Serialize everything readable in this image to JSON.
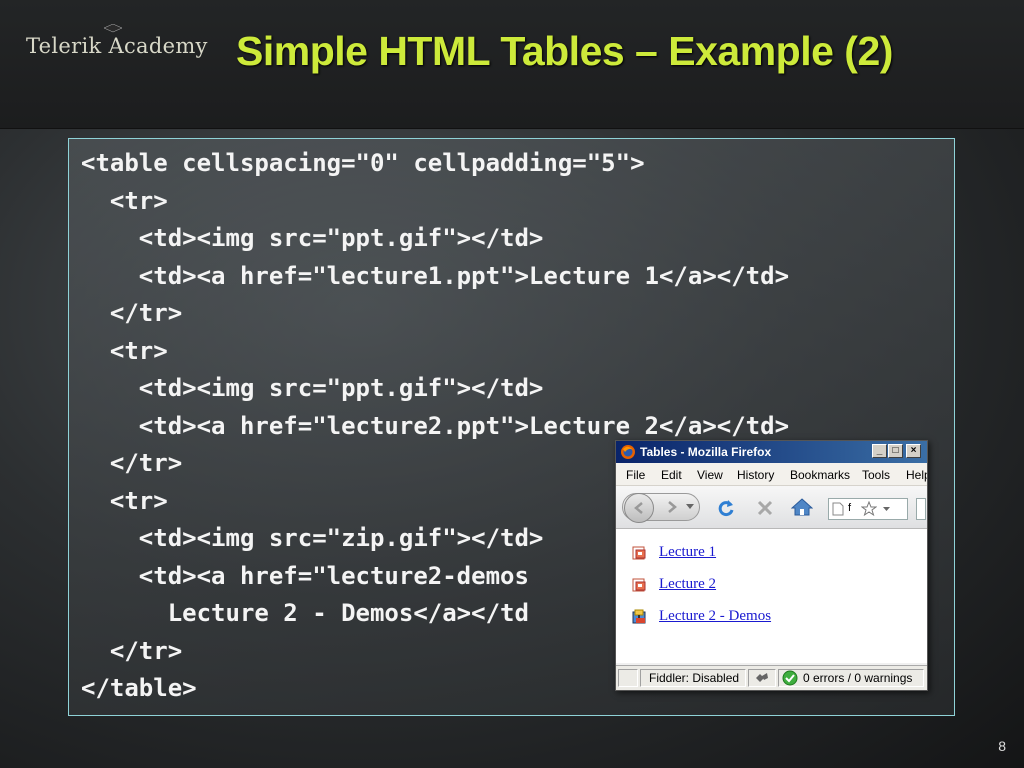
{
  "brand": {
    "logo_text": "Telerik Academy"
  },
  "slide": {
    "title": "Simple HTML Tables – Example (2)",
    "page_number": "8"
  },
  "code": {
    "lines": [
      "<table cellspacing=\"0\" cellpadding=\"5\">",
      "  <tr>",
      "    <td><img src=\"ppt.gif\"></td>",
      "    <td><a href=\"lecture1.ppt\">Lecture 1</a></td>",
      "  </tr>",
      "  <tr>",
      "    <td><img src=\"ppt.gif\"></td>",
      "    <td><a href=\"lecture2.ppt\">Lecture 2</a></td>",
      "  </tr>",
      "  <tr>",
      "    <td><img src=\"zip.gif\"></td>",
      "    <td><a href=\"lecture2-demos",
      "      Lecture 2 - Demos</a></td",
      "  </tr>",
      "</table>"
    ]
  },
  "browser": {
    "window_title": "Tables - Mozilla Firefox",
    "window_buttons": {
      "minimize": "_",
      "maximize": "□",
      "close": "×"
    },
    "menu": [
      "File",
      "Edit",
      "View",
      "History",
      "Bookmarks",
      "Tools",
      "Help"
    ],
    "url_fragment": "f",
    "links": [
      {
        "label": "Lecture 1",
        "icon": "ppt-file-icon"
      },
      {
        "label": "Lecture 2",
        "icon": "ppt-file-icon"
      },
      {
        "label": "Lecture 2 - Demos",
        "icon": "zip-file-icon"
      }
    ],
    "status": {
      "fiddler": "Fiddler: Disabled",
      "errors": "0 errors / 0 warnings"
    }
  },
  "colors": {
    "title": "#cdea3a",
    "code_text": "#f4f4f4",
    "code_border": "#8fd3d8",
    "link": "#1a1ad0",
    "titlebar": "#0a246a"
  }
}
